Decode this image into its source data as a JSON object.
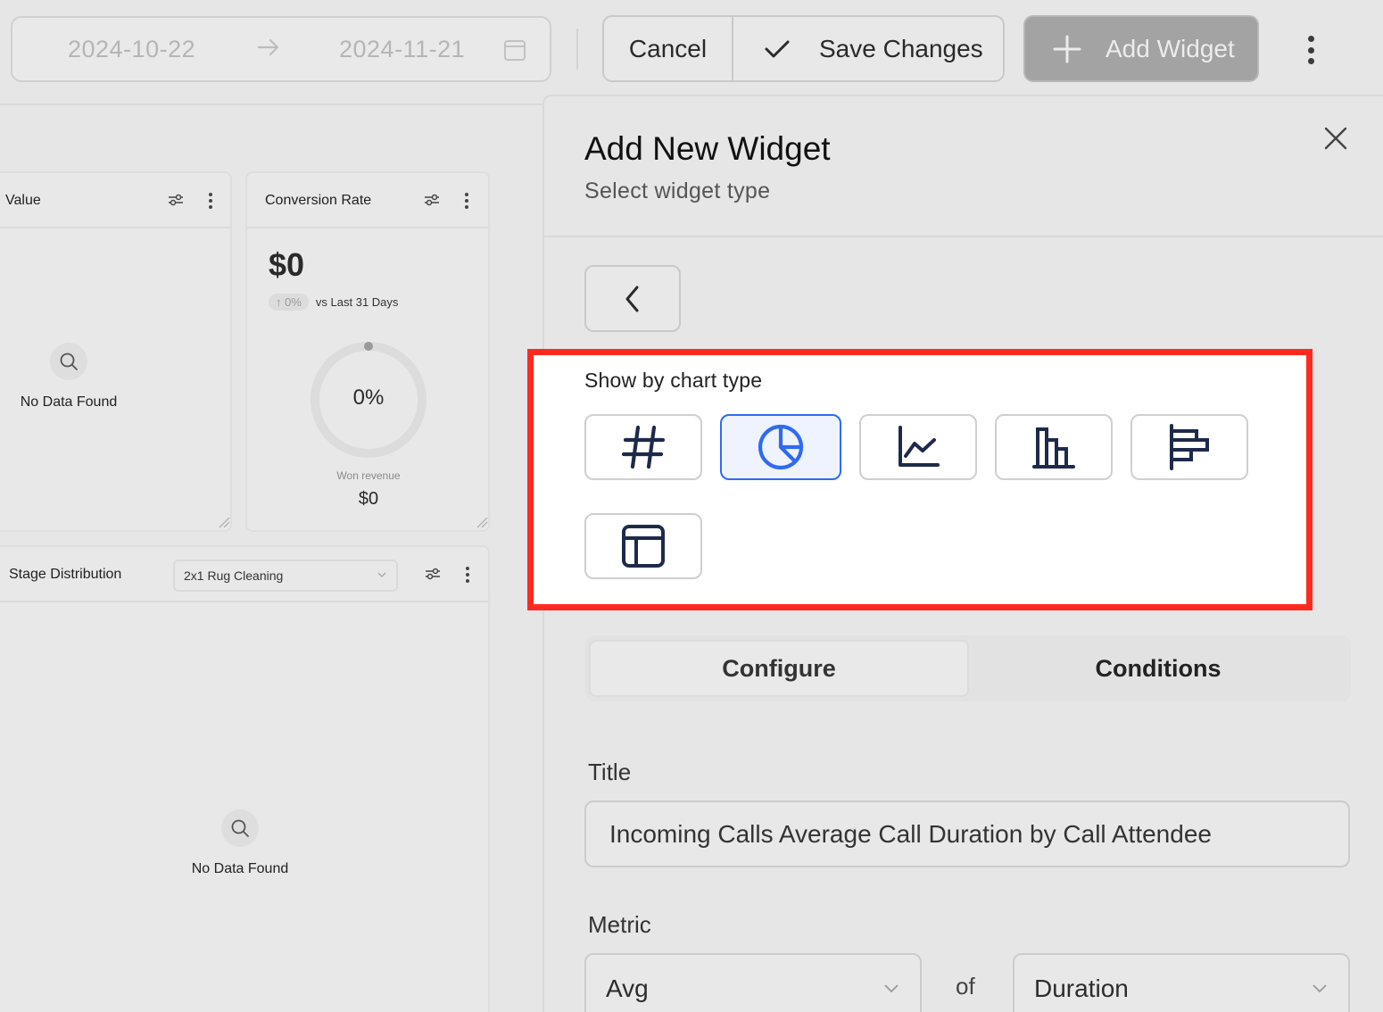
{
  "toolbar": {
    "date_start": "2024-10-22",
    "date_end": "2024-11-21",
    "cancel_label": "Cancel",
    "save_label": "Save Changes",
    "add_widget_label": "Add Widget"
  },
  "dashboard": {
    "value_card": {
      "title": "Value",
      "empty_text": "No Data Found"
    },
    "conversion_card": {
      "title": "Conversion Rate",
      "value": "$0",
      "trend_pct": "0%",
      "trend_compare": "vs Last 31 Days",
      "gauge_pct": "0%",
      "gauge_progress": 0,
      "won_label": "Won revenue",
      "won_value": "$0"
    },
    "stage_card": {
      "title": "Stage Distribution",
      "pipeline_select": "2x1 Rug Cleaning",
      "empty_text": "No Data Found"
    }
  },
  "panel": {
    "title": "Add New Widget",
    "subtitle": "Select widget type",
    "chart_type_label": "Show by chart type",
    "chart_types": [
      {
        "name": "number",
        "icon": "hash-icon",
        "selected": false
      },
      {
        "name": "pie",
        "icon": "pie-chart-icon",
        "selected": true
      },
      {
        "name": "line",
        "icon": "line-chart-icon",
        "selected": false
      },
      {
        "name": "bar",
        "icon": "bar-chart-icon",
        "selected": false
      },
      {
        "name": "horizontal-bar",
        "icon": "horizontal-bar-chart-icon",
        "selected": false
      },
      {
        "name": "table",
        "icon": "table-icon",
        "selected": false
      }
    ],
    "tabs": {
      "configure": "Configure",
      "conditions": "Conditions"
    },
    "title_label": "Title",
    "title_value": "Incoming Calls Average Call Duration by Call Attendee",
    "metric_label": "Metric",
    "metric_aggregate": "Avg",
    "of_label": "of",
    "metric_field": "Duration"
  },
  "colors": {
    "highlight": "#ff2a1f",
    "selected_accent": "#2f6bf2",
    "icon_dark": "#1e2a4a"
  }
}
